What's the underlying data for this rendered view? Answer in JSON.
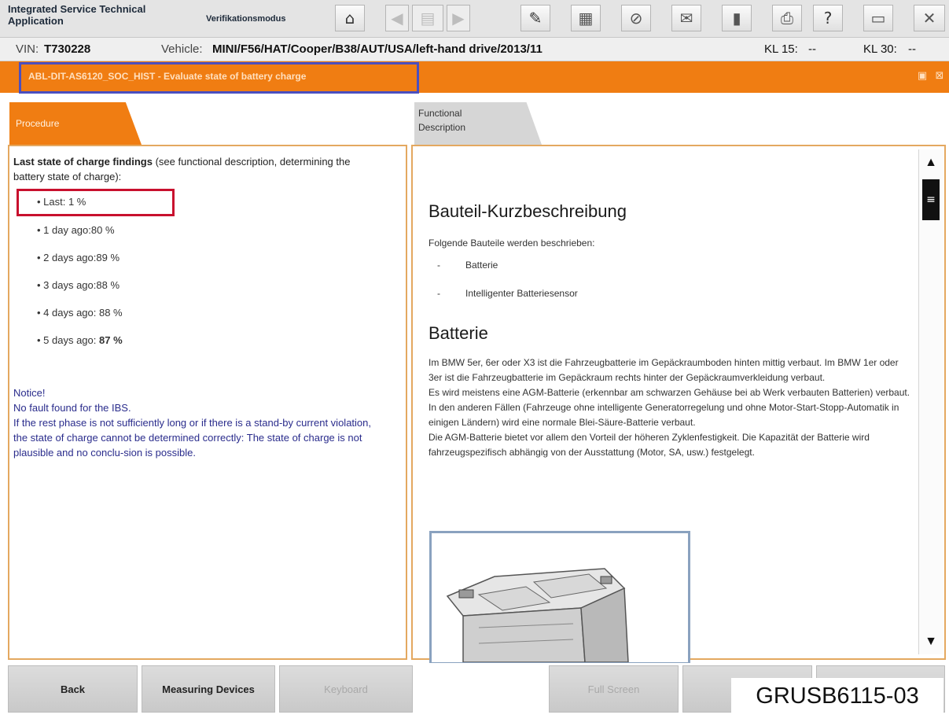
{
  "toolbar": {
    "app_title": "Integrated Service Technical Application",
    "mode": "Verifikationsmodus",
    "icons": [
      "home-icon",
      "arrow-left-icon",
      "document-icon",
      "arrow-right-icon",
      "wrench-icon",
      "catalog-icon",
      "no-connection-icon",
      "mail-icon",
      "device-icon",
      "print-icon",
      "help-icon",
      "minimize-icon",
      "close-icon"
    ],
    "glyphs": {
      "home": "⌂",
      "back": "◀",
      "doc": "▤",
      "forward": "▶",
      "wrench": "✎",
      "catalog": "▦",
      "noconn": "⊘",
      "mail": "✉",
      "device": "▮",
      "print": "⎙",
      "help": "?",
      "minimize": "▭",
      "close": "✕"
    }
  },
  "vehicle_bar": {
    "vin_label": "VIN:",
    "vin_value": "T730228",
    "vehicle_label": "Vehicle:",
    "vehicle_value": "MINI/F56/HAT/Cooper/B38/AUT/USA/left-hand drive/2013/11",
    "kl15_label": "KL 15:",
    "kl15_value": "--",
    "kl30_label": "KL 30:",
    "kl30_value": "--"
  },
  "title_bar": {
    "title": "ABL-DIT-AS6120_SOC_HIST  -  Evaluate state of battery charge",
    "glyph_minimize": "▣",
    "glyph_close": "⊠"
  },
  "tabs": {
    "procedure": "Procedure",
    "functional": "Functional Description"
  },
  "left_panel": {
    "heading_bold": "Last state of charge findings",
    "heading_rest": " (see functional description, determining the battery state of charge):",
    "findings": [
      "• Last: 1 %",
      "• 1 day ago:80 %",
      "• 2 days ago:89 %",
      "• 3 days ago:88 %",
      "• 4 days ago: 88 %"
    ],
    "finding_last_prefix": "• 5 days ago: ",
    "finding_last_bold": "87 %",
    "notice_title": "Notice!",
    "notice_lines": [
      "No fault found for the IBS.",
      "If the rest phase is not sufficiently long or if there is a stand-by current violation, the state of charge cannot be determined correctly: The state of charge is not plausible and no conclu-sion is possible."
    ]
  },
  "right_panel": {
    "heading1": "Bauteil-Kurzbeschreibung",
    "intro": "Folgende Bauteile werden beschrieben:",
    "items": [
      "Batterie",
      "Intelligenter Batteriesensor"
    ],
    "item_dash": "-",
    "heading2": "Batterie",
    "paragraphs": [
      "Im BMW 5er, 6er oder X3 ist die Fahrzeugbatterie im Gepäckraumboden hinten mittig verbaut. Im BMW 1er oder 3er ist die Fahrzeugbatterie im Gepäckraum rechts hinter der Gepäckraumverkleidung verbaut.",
      "Es wird meistens eine AGM-Batterie (erkennbar am schwarzen Gehäuse bei ab Werk verbauten Batterien) verbaut. In den anderen Fällen (Fahrzeuge ohne intelligente Generatorregelung und ohne Motor-Start-Stopp-Automatik in einigen Ländern) wird eine normale Blei-Säure-Batterie verbaut.",
      "Die AGM-Batterie bietet vor allem den Vorteil der höheren Zyklenfestigkeit. Die Kapazität der Batterie wird fahrzeugspezifisch abhängig von der Ausstattung (Motor, SA, usw.) festgelegt."
    ],
    "scroll_up": "▲",
    "scroll_thumb": "≡",
    "scroll_down": "▼"
  },
  "bottom_buttons": {
    "back": "Back",
    "measuring": "Measuring Devices",
    "keyboard": "Keyboard",
    "fullscreen": "Full Screen"
  },
  "watermark": "GRUSB6115-03"
}
